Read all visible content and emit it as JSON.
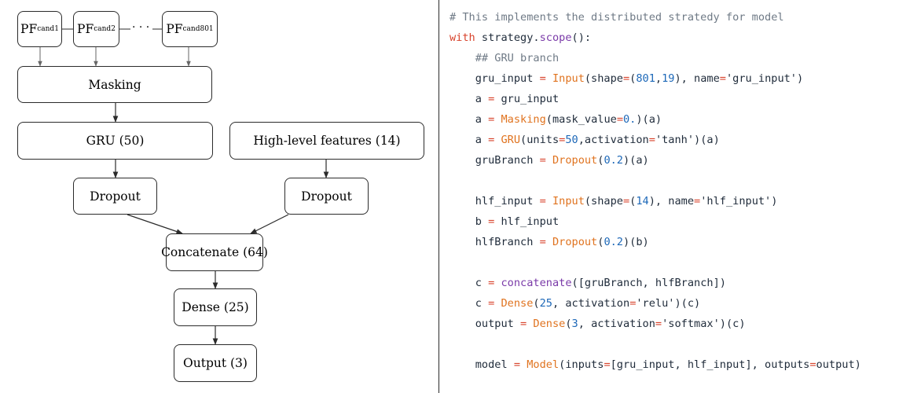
{
  "diagram": {
    "pf": [
      {
        "base": "PF",
        "sub": "cand",
        "idx": "1"
      },
      {
        "base": "PF",
        "sub": "cand",
        "idx": "2"
      },
      {
        "base": "PF",
        "sub": "cand",
        "idx": "801"
      }
    ],
    "ellipsis": "· · ·",
    "masking": "Masking",
    "gru": "GRU (50)",
    "hlf": "High-level features (14)",
    "dropout_left": "Dropout",
    "dropout_right": "Dropout",
    "concatenate": "Concatenate (64)",
    "dense": "Dense (25)",
    "output": "Output (3)"
  },
  "code": {
    "lines": [
      [
        {
          "t": "# This implements the distributed stratedy for model",
          "c": "cmt"
        }
      ],
      [
        {
          "t": "with",
          "c": "kw"
        },
        {
          "t": " strategy."
        },
        {
          "t": "scope",
          "c": "mt"
        },
        {
          "t": "():"
        }
      ],
      [
        {
          "t": "    ## GRU branch",
          "c": "cmt"
        }
      ],
      [
        {
          "t": "    gru_input "
        },
        {
          "t": "=",
          "c": "kw"
        },
        {
          "t": " "
        },
        {
          "t": "Input",
          "c": "fn"
        },
        {
          "t": "(shape"
        },
        {
          "t": "=",
          "c": "kw"
        },
        {
          "t": "("
        },
        {
          "t": "801",
          "c": "num"
        },
        {
          "t": ","
        },
        {
          "t": "19",
          "c": "num"
        },
        {
          "t": "), name"
        },
        {
          "t": "=",
          "c": "kw"
        },
        {
          "t": "'gru_input'",
          "c": "str"
        },
        {
          "t": ")"
        }
      ],
      [
        {
          "t": "    a "
        },
        {
          "t": "=",
          "c": "kw"
        },
        {
          "t": " gru_input"
        }
      ],
      [
        {
          "t": "    a "
        },
        {
          "t": "=",
          "c": "kw"
        },
        {
          "t": " "
        },
        {
          "t": "Masking",
          "c": "fn"
        },
        {
          "t": "(mask_value"
        },
        {
          "t": "=",
          "c": "kw"
        },
        {
          "t": "0.",
          "c": "num"
        },
        {
          "t": ")(a)"
        }
      ],
      [
        {
          "t": "    a "
        },
        {
          "t": "=",
          "c": "kw"
        },
        {
          "t": " "
        },
        {
          "t": "GRU",
          "c": "fn"
        },
        {
          "t": "(units"
        },
        {
          "t": "=",
          "c": "kw"
        },
        {
          "t": "50",
          "c": "num"
        },
        {
          "t": ",activation"
        },
        {
          "t": "=",
          "c": "kw"
        },
        {
          "t": "'tanh'",
          "c": "str"
        },
        {
          "t": ")(a)"
        }
      ],
      [
        {
          "t": "    gruBranch "
        },
        {
          "t": "=",
          "c": "kw"
        },
        {
          "t": " "
        },
        {
          "t": "Dropout",
          "c": "fn"
        },
        {
          "t": "("
        },
        {
          "t": "0.2",
          "c": "num"
        },
        {
          "t": ")(a)"
        }
      ],
      [],
      [
        {
          "t": "    hlf_input "
        },
        {
          "t": "=",
          "c": "kw"
        },
        {
          "t": " "
        },
        {
          "t": "Input",
          "c": "fn"
        },
        {
          "t": "(shape"
        },
        {
          "t": "=",
          "c": "kw"
        },
        {
          "t": "("
        },
        {
          "t": "14",
          "c": "num"
        },
        {
          "t": "), name"
        },
        {
          "t": "=",
          "c": "kw"
        },
        {
          "t": "'hlf_input'",
          "c": "str"
        },
        {
          "t": ")"
        }
      ],
      [
        {
          "t": "    b "
        },
        {
          "t": "=",
          "c": "kw"
        },
        {
          "t": " hlf_input"
        }
      ],
      [
        {
          "t": "    hlfBranch "
        },
        {
          "t": "=",
          "c": "kw"
        },
        {
          "t": " "
        },
        {
          "t": "Dropout",
          "c": "fn"
        },
        {
          "t": "("
        },
        {
          "t": "0.2",
          "c": "num"
        },
        {
          "t": ")(b)"
        }
      ],
      [],
      [
        {
          "t": "    c "
        },
        {
          "t": "=",
          "c": "kw"
        },
        {
          "t": " "
        },
        {
          "t": "concatenate",
          "c": "mt"
        },
        {
          "t": "([gruBranch, hlfBranch])"
        }
      ],
      [
        {
          "t": "    c "
        },
        {
          "t": "=",
          "c": "kw"
        },
        {
          "t": " "
        },
        {
          "t": "Dense",
          "c": "fn"
        },
        {
          "t": "("
        },
        {
          "t": "25",
          "c": "num"
        },
        {
          "t": ", activation"
        },
        {
          "t": "=",
          "c": "kw"
        },
        {
          "t": "'relu'",
          "c": "str"
        },
        {
          "t": ")(c)"
        }
      ],
      [
        {
          "t": "    output "
        },
        {
          "t": "=",
          "c": "kw"
        },
        {
          "t": " "
        },
        {
          "t": "Dense",
          "c": "fn"
        },
        {
          "t": "("
        },
        {
          "t": "3",
          "c": "num"
        },
        {
          "t": ", activation"
        },
        {
          "t": "=",
          "c": "kw"
        },
        {
          "t": "'softmax'",
          "c": "str"
        },
        {
          "t": ")(c)"
        }
      ],
      [],
      [
        {
          "t": "    model "
        },
        {
          "t": "=",
          "c": "kw"
        },
        {
          "t": " "
        },
        {
          "t": "Model",
          "c": "fn"
        },
        {
          "t": "(inputs"
        },
        {
          "t": "=",
          "c": "kw"
        },
        {
          "t": "[gru_input, hlf_input], outputs"
        },
        {
          "t": "=",
          "c": "kw"
        },
        {
          "t": "output)"
        }
      ]
    ]
  }
}
